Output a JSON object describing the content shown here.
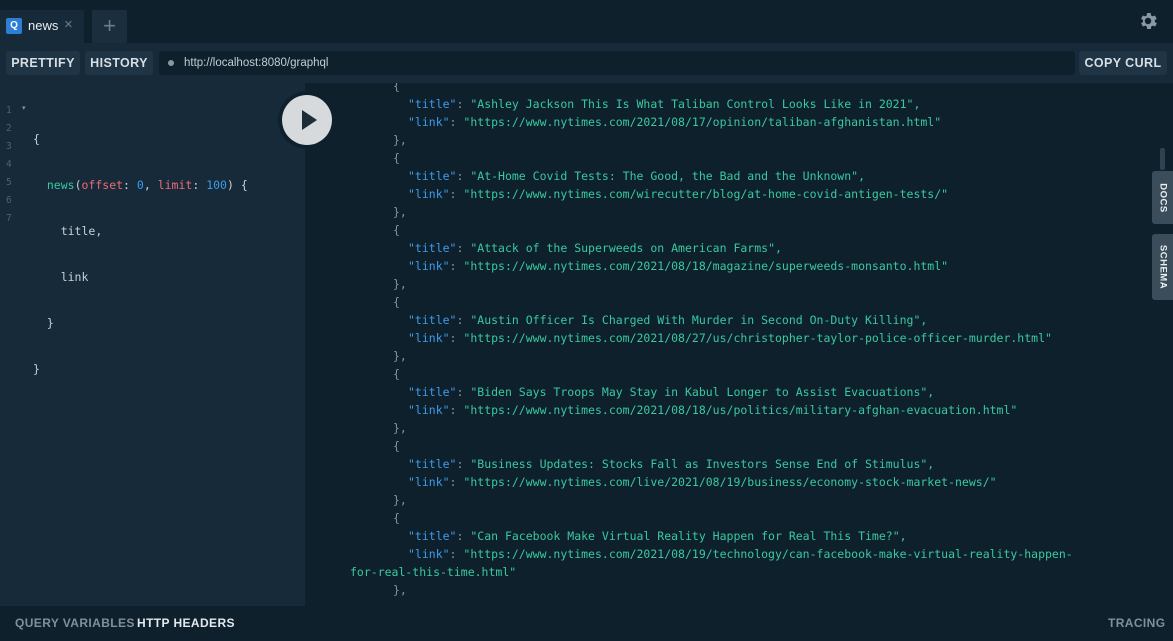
{
  "tabs": [
    {
      "badge": "Q",
      "title": "news",
      "close": "×"
    }
  ],
  "new_tab": "+",
  "toolbar": {
    "prettify": "PRETTIFY",
    "history": "HISTORY",
    "url": "http://localhost:8080/graphql",
    "copy_curl": "COPY CURL"
  },
  "query": {
    "line_numbers": [
      "1",
      "2",
      "3",
      "4",
      "5",
      "6",
      "7"
    ],
    "fold_marker": "▾",
    "lines": [
      {
        "text": "{"
      },
      {
        "field": "news",
        "open": "(",
        "arg1": "offset",
        "colon1": ": ",
        "val1": "0",
        "sep": ", ",
        "arg2": "limit",
        "colon2": ": ",
        "val2": "100",
        "close": ") {"
      },
      {
        "text": "title,"
      },
      {
        "text": "link"
      },
      {
        "text": "}"
      },
      {
        "text": "}"
      },
      {
        "text": ""
      }
    ]
  },
  "results": [
    {
      "title": "Ashley Jackson This Is What Taliban Control Looks Like in 2021",
      "link": "https://www.nytimes.com/2021/08/17/opinion/taliban-afghanistan.html"
    },
    {
      "title": "At-Home Covid Tests: The Good, the Bad and the Unknown",
      "link": "https://www.nytimes.com/wirecutter/blog/at-home-covid-antigen-tests/"
    },
    {
      "title": "Attack of the Superweeds on American Farms",
      "link": "https://www.nytimes.com/2021/08/18/magazine/superweeds-monsanto.html"
    },
    {
      "title": "Austin Officer Is Charged With Murder in Second On-Duty Killing",
      "link": "https://www.nytimes.com/2021/08/27/us/christopher-taylor-police-officer-murder.html"
    },
    {
      "title": "Biden Says Troops May Stay in Kabul Longer to Assist Evacuations",
      "link": "https://www.nytimes.com/2021/08/18/us/politics/military-afghan-evacuation.html"
    },
    {
      "title": "Business Updates: Stocks Fall as Investors Sense End of Stimulus",
      "link": "https://www.nytimes.com/live/2021/08/19/business/economy-stock-market-news/"
    },
    {
      "title": "Can Facebook Make Virtual Reality Happen for Real This Time?",
      "link_part1": "https://www.nytimes.com/2021/08/19/technology/can-facebook-make-virtual-reality-happen-",
      "link_part2": "for-real-this-time.html"
    }
  ],
  "result_keys": {
    "title": "\"title\"",
    "link": "\"link\""
  },
  "side_tabs": {
    "docs": "DOCS",
    "schema": "SCHEMA"
  },
  "footer": {
    "query_variables": "QUERY VARIABLES",
    "http_headers": "HTTP HEADERS",
    "tracing": "TRACING"
  },
  "colors": {
    "background": "#172a3a",
    "panel_dark": "#0f202d",
    "string": "#39c8a0",
    "key": "#3d9be9",
    "argument": "#ef6b73"
  },
  "icons": [
    "settings-gear-icon",
    "play-icon",
    "url-status-dot-icon"
  ]
}
